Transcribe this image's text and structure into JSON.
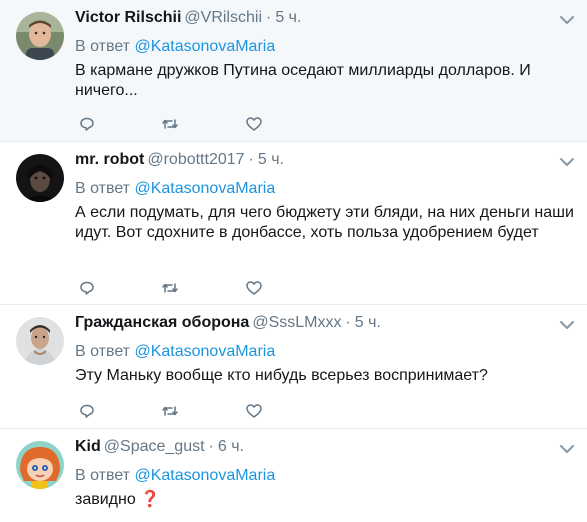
{
  "tweets": [
    {
      "name": "Victor Rilschii",
      "handle": "@VRilschii",
      "separator": "·",
      "time": "5 ч.",
      "reply_prefix": "В ответ",
      "reply_mention": "@KatasonovaMaria",
      "text": "В кармане дружков Путина оседают миллиарды долларов. И ничего...",
      "avatar": "man-face-avatar"
    },
    {
      "name": "mr. robot",
      "handle": "@robottt2017",
      "separator": "·",
      "time": "5 ч.",
      "reply_prefix": "В ответ",
      "reply_mention": "@KatasonovaMaria",
      "text": "А если подумать, для чего бюджету эти бляди, на них деньги наши идут. Вот сдохните в донбассе, хоть польза удобрением будет",
      "avatar": "dark-portrait-avatar"
    },
    {
      "name": "Гражданская оборона",
      "handle": "@SssLMxxx",
      "separator": "·",
      "time": "5 ч.",
      "reply_prefix": "В ответ",
      "reply_mention": "@KatasonovaMaria",
      "text": "Эту Маньку вообще кто нибудь всерьез воспринимает?",
      "avatar": "man-selfie-avatar"
    },
    {
      "name": "Kid",
      "handle": "@Space_gust",
      "separator": "·",
      "time": "6 ч.",
      "reply_prefix": "В ответ",
      "reply_mention": "@KatasonovaMaria",
      "text": "завидно ❓",
      "avatar": "cartoon-kid-avatar"
    }
  ],
  "icons": {
    "reply": "reply-icon",
    "retweet": "retweet-icon",
    "like": "heart-icon",
    "menu": "chevron-down-icon"
  },
  "colors": {
    "highlight_bg": "#f5f8fa",
    "secondary_text": "#657786",
    "mention": "#1b95e0",
    "divider": "#e6ecf0"
  }
}
